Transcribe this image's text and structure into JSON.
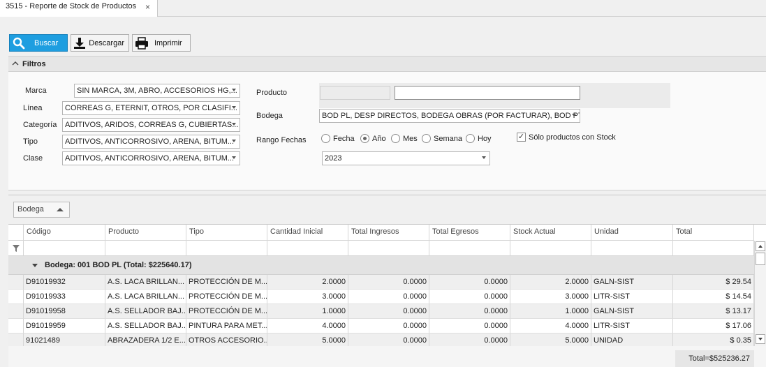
{
  "tab": {
    "title": "3515 - Reporte de Stock de Productos",
    "close": "×"
  },
  "toolbar": {
    "search_label": "Buscar",
    "download_label": "Descargar",
    "print_label": "Imprimir"
  },
  "filters": {
    "title": "Filtros",
    "marca_label": "Marca",
    "marca_value": "SIN MARCA, 3M, ABRO, ACCESORIOS HG,...",
    "linea_label": "Línea",
    "linea_value": "CORREAS G, ETERNIT, OTROS, POR CLASIFI...",
    "categoria_label": "Categoría",
    "categoria_value": "ADITIVOS, ARIDOS, CORREAS G, CUBIERTAS...",
    "tipo_label": "Tipo",
    "tipo_value": "ADITIVOS, ANTICORROSIVO, ARENA, BITUM...",
    "clase_label": "Clase",
    "clase_value": "ADITIVOS, ANTICORROSIVO, ARENA, BITUM...",
    "producto_label": "Producto",
    "bodega_label": "Bodega",
    "bodega_value": "BOD PL, DESP DIRECTOS, BODEGA OBRAS (POR FACTURAR), BOD PT...",
    "rango_label": "Rango Fechas",
    "radios": [
      "Fecha",
      "Año",
      "Mes",
      "Semana",
      "Hoy"
    ],
    "selected_radio": "Año",
    "year_value": "2023",
    "stock_check_label": "Sólo productos con Stock",
    "stock_check_mark": "✓"
  },
  "grid": {
    "group_chip": "Bodega",
    "columns": [
      "Código",
      "Producto",
      "Tipo",
      "Cantidad Inicial",
      "Total Ingresos",
      "Total Egresos",
      "Stock Actual",
      "Unidad",
      "Total"
    ],
    "group_row": "Bodega: 001 BOD PL (Total: $225640.17)",
    "rows": [
      [
        "D91019932",
        "A.S. LACA BRILLAN...",
        "PROTECCIÓN DE M...",
        "2.0000",
        "0.0000",
        "0.0000",
        "2.0000",
        "GALN-SIST",
        "$ 29.54"
      ],
      [
        "D91019933",
        "A.S. LACA BRILLAN...",
        "PROTECCIÓN DE M...",
        "3.0000",
        "0.0000",
        "0.0000",
        "3.0000",
        "LITR-SIST",
        "$ 14.54"
      ],
      [
        "D91019958",
        "A.S. SELLADOR BAJ...",
        "PROTECCIÓN DE M...",
        "1.0000",
        "0.0000",
        "0.0000",
        "1.0000",
        "GALN-SIST",
        "$ 13.17"
      ],
      [
        "D91019959",
        "A.S. SELLADOR BAJ...",
        "PINTURA PARA MET...",
        "4.0000",
        "0.0000",
        "0.0000",
        "4.0000",
        "LITR-SIST",
        "$ 17.06"
      ],
      [
        "91021489",
        "ABRAZADERA 1/2 E...",
        "OTROS ACCESORIO...",
        "5.0000",
        "0.0000",
        "0.0000",
        "5.0000",
        "UNIDAD",
        "$ 0.35"
      ]
    ],
    "total": "Total=$525236.27"
  }
}
